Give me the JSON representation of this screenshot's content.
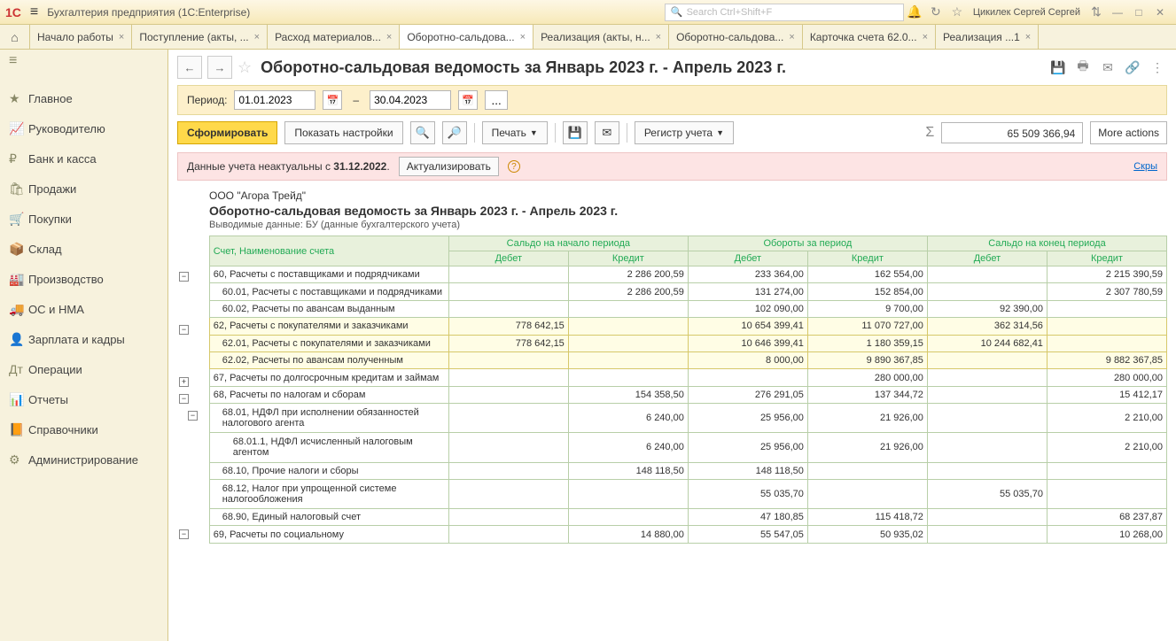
{
  "app_title": "Бухгалтерия предприятия  (1C:Enterprise)",
  "search_placeholder": "Search Ctrl+Shift+F",
  "user_name": "Цикилек Сергей Сергей",
  "tabs": [
    {
      "label": "Начало работы"
    },
    {
      "label": "Поступление (акты, ..."
    },
    {
      "label": "Расход материалов..."
    },
    {
      "label": "Оборотно-сальдова...",
      "active": true
    },
    {
      "label": "Реализация (акты, н..."
    },
    {
      "label": "Оборотно-сальдова..."
    },
    {
      "label": "Карточка счета 62.0..."
    },
    {
      "label": "Реализация ...1"
    }
  ],
  "sidebar": [
    {
      "icon": "≡",
      "label": ""
    },
    {
      "icon": "★",
      "label": "Главное"
    },
    {
      "icon": "📈",
      "label": "Руководителю"
    },
    {
      "icon": "₽",
      "label": "Банк и касса"
    },
    {
      "icon": "🛍",
      "label": "Продажи"
    },
    {
      "icon": "🛒",
      "label": "Покупки"
    },
    {
      "icon": "📦",
      "label": "Склад"
    },
    {
      "icon": "🏭",
      "label": "Производство"
    },
    {
      "icon": "🚚",
      "label": "ОС и НМА"
    },
    {
      "icon": "👤",
      "label": "Зарплата и кадры"
    },
    {
      "icon": "Дт",
      "label": "Операции"
    },
    {
      "icon": "📊",
      "label": "Отчеты"
    },
    {
      "icon": "📙",
      "label": "Справочники"
    },
    {
      "icon": "⚙",
      "label": "Администрирование"
    }
  ],
  "page_title": "Оборотно-сальдовая ведомость за Январь 2023 г. - Апрель 2023 г.",
  "period_label": "Период:",
  "date_from": "01.01.2023",
  "date_to": "30.04.2023",
  "btn_form": "Сформировать",
  "btn_settings": "Показать настройки",
  "btn_print": "Печать",
  "btn_register": "Регистр учета",
  "btn_more": "More actions",
  "total": "65 509 366,94",
  "warn_text": "Данные учета неактуальны с ",
  "warn_date": "31.12.2022",
  "btn_actual": "Актуализировать",
  "hide_label": "Скры",
  "org": "ООО \"Агора Трейд\"",
  "report_title": "Оборотно-сальдовая ведомость за Январь 2023 г. - Апрель 2023 г.",
  "report_sub": "Выводимые данные: БУ (данные бухгалтерского учета)",
  "headers": {
    "acc": "Счет, Наименование счета",
    "g1": "Сальдо на начало периода",
    "g2": "Обороты за период",
    "g3": "Сальдо на конец периода",
    "dt": "Дебет",
    "kt": "Кредит"
  },
  "rows": [
    {
      "tree": "-",
      "lvl": 0,
      "name": "60, Расчеты с поставщиками и подрядчиками",
      "d1": "",
      "k1": "2 286 200,59",
      "d2": "233 364,00",
      "k2": "162 554,00",
      "d3": "",
      "k3": "2 215 390,59"
    },
    {
      "tree": "",
      "lvl": 1,
      "name": "60.01, Расчеты с поставщиками и подрядчиками",
      "d1": "",
      "k1": "2 286 200,59",
      "d2": "131 274,00",
      "k2": "152 854,00",
      "d3": "",
      "k3": "2 307 780,59"
    },
    {
      "tree": "",
      "lvl": 1,
      "name": "60.02, Расчеты по авансам выданным",
      "d1": "",
      "k1": "",
      "d2": "102 090,00",
      "k2": "9 700,00",
      "d3": "92 390,00",
      "k3": ""
    },
    {
      "tree": "-",
      "lvl": 0,
      "hl": true,
      "name": "62, Расчеты с покупателями и заказчиками",
      "d1": "778 642,15",
      "k1": "",
      "d2": "10 654 399,41",
      "k2": "11 070 727,00",
      "d3": "362 314,56",
      "k3": ""
    },
    {
      "tree": "",
      "lvl": 1,
      "hl": true,
      "name": "62.01, Расчеты с покупателями и заказчиками",
      "d1": "778 642,15",
      "k1": "",
      "d2": "10 646 399,41",
      "k2": "1 180 359,15",
      "d3": "10 244 682,41",
      "k3": ""
    },
    {
      "tree": "",
      "lvl": 1,
      "hl": true,
      "name": "62.02, Расчеты по авансам полученным",
      "d1": "",
      "k1": "",
      "d2": "8 000,00",
      "k2": "9 890 367,85",
      "d3": "",
      "k3": "9 882 367,85"
    },
    {
      "tree": "+",
      "lvl": 0,
      "name": "67, Расчеты по долгосрочным кредитам и займам",
      "d1": "",
      "k1": "",
      "d2": "",
      "k2": "280 000,00",
      "d3": "",
      "k3": "280 000,00"
    },
    {
      "tree": "-",
      "lvl": 0,
      "name": "68, Расчеты по налогам и сборам",
      "d1": "",
      "k1": "154 358,50",
      "d2": "276 291,05",
      "k2": "137 344,72",
      "d3": "",
      "k3": "15 412,17"
    },
    {
      "tree": "-",
      "lvl": 1,
      "name": "68.01, НДФЛ при исполнении обязанностей налогового агента",
      "d1": "",
      "k1": "6 240,00",
      "d2": "25 956,00",
      "k2": "21 926,00",
      "d3": "",
      "k3": "2 210,00"
    },
    {
      "tree": "",
      "lvl": 2,
      "name": "68.01.1, НДФЛ исчисленный налоговым агентом",
      "d1": "",
      "k1": "6 240,00",
      "d2": "25 956,00",
      "k2": "21 926,00",
      "d3": "",
      "k3": "2 210,00"
    },
    {
      "tree": "",
      "lvl": 1,
      "name": "68.10, Прочие налоги и сборы",
      "d1": "",
      "k1": "148 118,50",
      "d2": "148 118,50",
      "k2": "",
      "d3": "",
      "k3": ""
    },
    {
      "tree": "",
      "lvl": 1,
      "name": "68.12, Налог при упрощенной системе налогообложения",
      "d1": "",
      "k1": "",
      "d2": "55 035,70",
      "k2": "",
      "d3": "55 035,70",
      "k3": ""
    },
    {
      "tree": "",
      "lvl": 1,
      "name": "68.90, Единый налоговый счет",
      "d1": "",
      "k1": "",
      "d2": "47 180,85",
      "k2": "115 418,72",
      "d3": "",
      "k3": "68 237,87"
    },
    {
      "tree": "-",
      "lvl": 0,
      "name": "69, Расчеты по социальному",
      "d1": "",
      "k1": "14 880,00",
      "d2": "55 547,05",
      "k2": "50 935,02",
      "d3": "",
      "k3": "10 268,00"
    }
  ]
}
